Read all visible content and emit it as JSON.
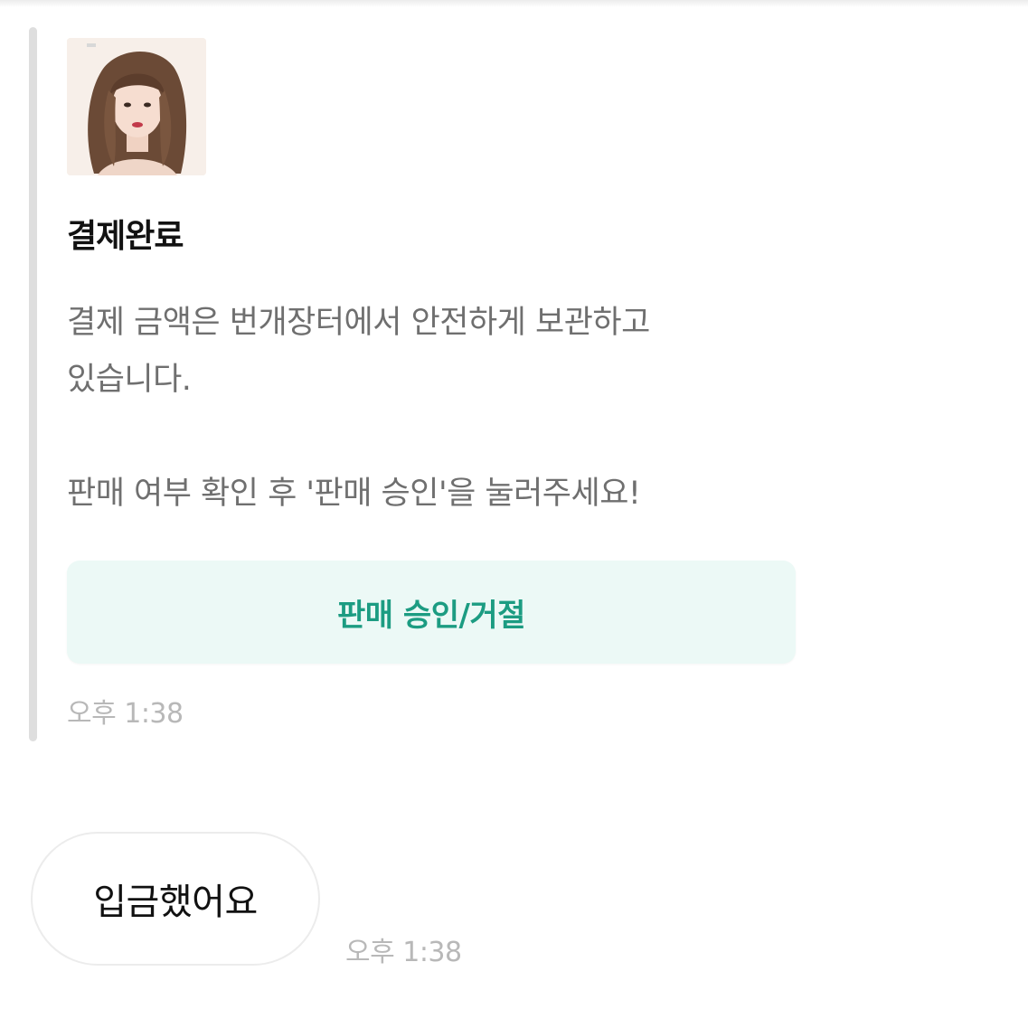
{
  "card": {
    "thumbnail_icon": "product-photo",
    "title": "결제완료",
    "body_line_1": "결제 금액은 번개장터에서 안전하게 보관하고",
    "body_line_2": "있습니다.",
    "body_line_3": "판매 여부 확인 후 '판매 승인'을 눌러주세요!",
    "button_label": "판매 승인/거절",
    "time": "오후 1:38"
  },
  "message": {
    "text": "입금했어요",
    "time": "오후 1:38"
  },
  "colors": {
    "accent_bar": "#dedede",
    "button_bg": "#ecf9f6",
    "button_text": "#1c9c82",
    "body_text": "#6f6f6f",
    "time_text": "#b8b8b8"
  }
}
